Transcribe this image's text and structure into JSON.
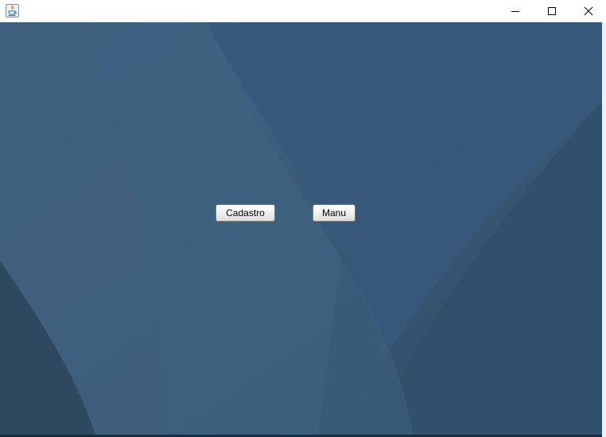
{
  "window": {
    "app_icon": "java-coffee-cup-icon",
    "controls": {
      "minimize_icon": "minimize-icon",
      "maximize_icon": "maximize-icon",
      "close_icon": "close-icon"
    }
  },
  "main": {
    "buttons": {
      "cadastro_label": "Cadastro",
      "manu_label": "Manu"
    }
  },
  "colors": {
    "background": "#3b5b78",
    "titlebar": "#ffffff",
    "button_face": "#f2f2f2"
  }
}
